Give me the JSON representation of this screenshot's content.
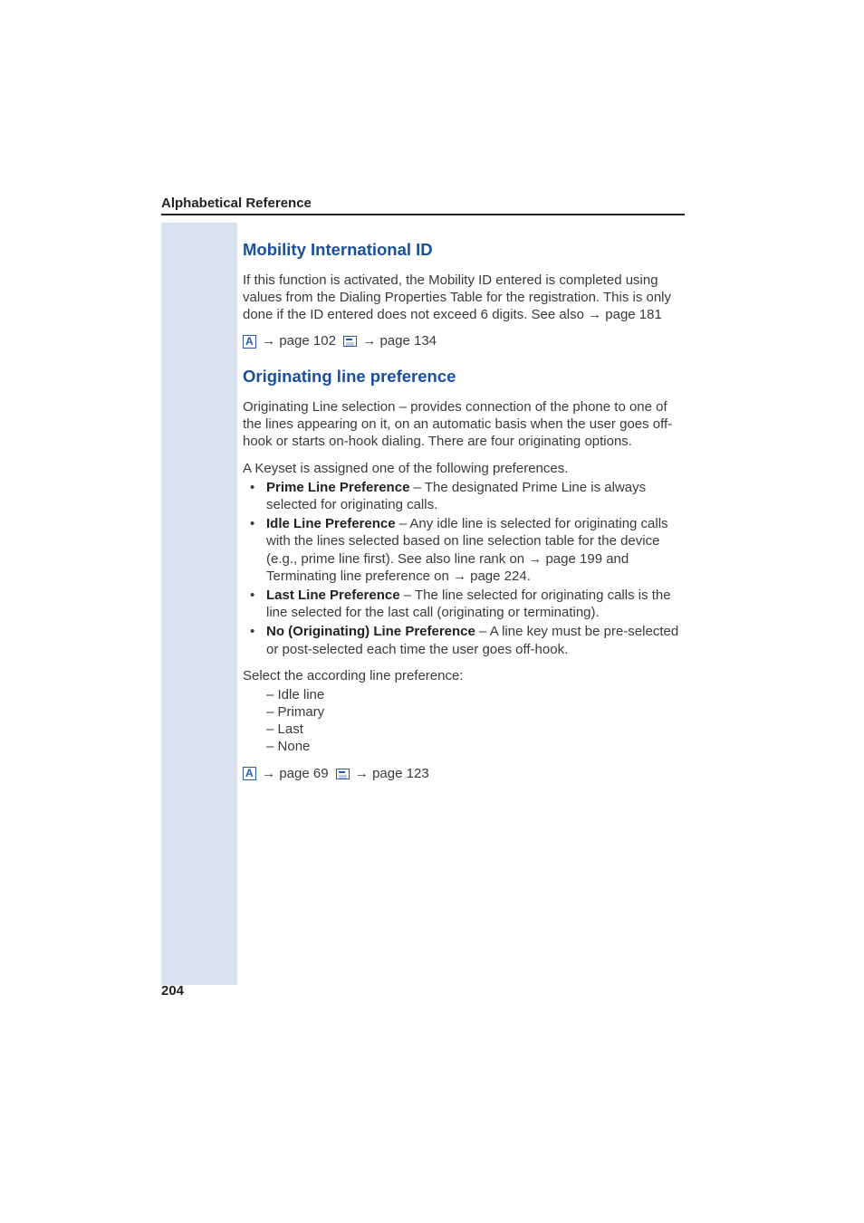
{
  "header": {
    "title": "Alphabetical Reference"
  },
  "section1": {
    "heading": "Mobility International ID",
    "para1_a": "If this function is activated, the Mobility ID entered is completed using values from the Dialing Properties Table for the registration. This is only done if the ID entered does not exceed 6 digits. See also ",
    "para1_link": "page 181",
    "ref1_text": "page 102",
    "ref2_text": "page 134"
  },
  "section2": {
    "heading": "Originating line preference",
    "para1": "Originating Line selection – provides connection of the phone to one of the lines appearing on it, on an automatic basis when the user goes off-hook or starts on-hook dialing. There are four originating options.",
    "para2": "A Keyset is assigned one of the following preferences.",
    "bullets": [
      {
        "label": "Prime Line Preference",
        "text": " – The designated Prime Line is always selected for originating calls."
      },
      {
        "label": "Idle Line Preference",
        "text_a": " – Any idle line is selected for originating calls with the lines selected based on line selection table for the device (e.g., prime line first). See also line rank on ",
        "link1": "page 199",
        "text_b": " and Terminating line preference on ",
        "link2": "page 224",
        "text_c": "."
      },
      {
        "label": "Last Line Preference",
        "text": " – The line selected for originating calls is the line selected for the last call (originating or terminating)."
      },
      {
        "label": "No (Originating) Line Preference",
        "text": " – A line key must be pre-selected or post-selected each time the user goes off-hook."
      }
    ],
    "para3": "Select the according line preference:",
    "options": [
      "Idle line",
      "Primary",
      "Last",
      "None"
    ],
    "ref1_text": "page 69",
    "ref2_text": "page 123"
  },
  "arrow": "→",
  "page_number": "204"
}
